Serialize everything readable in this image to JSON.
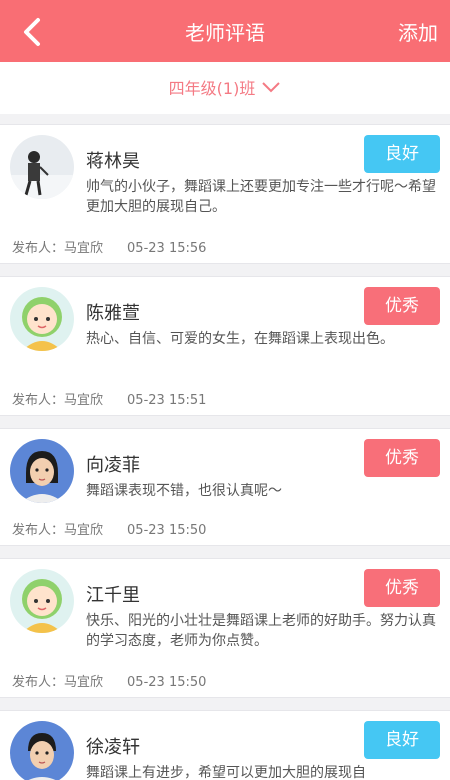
{
  "header": {
    "title": "老师评语",
    "add_label": "添加"
  },
  "class_selector": {
    "label": "四年级(1)班"
  },
  "meta_prefix": "发布人：",
  "colors": {
    "header": "#f96e74",
    "badge_good": "#45c7f3",
    "badge_excellent": "#f86f79"
  },
  "comments": [
    {
      "name": "蒋林昊",
      "badge": "良好",
      "badge_type": "good",
      "comment": "帅气的小伙子，舞蹈课上还要更加专注一些才行呢～希望更加大胆的展现自己。",
      "publisher": "马宜欣",
      "time": "05-23 15:56",
      "avatar_icon": "boy-photo-avatar"
    },
    {
      "name": "陈雅萱",
      "badge": "优秀",
      "badge_type": "excellent",
      "comment": "热心、自信、可爱的女生，在舞蹈课上表现出色。",
      "publisher": "马宜欣",
      "time": "05-23 15:51",
      "avatar_icon": "cartoon-avatar"
    },
    {
      "name": "向凌菲",
      "badge": "优秀",
      "badge_type": "excellent",
      "comment": "舞蹈课表现不错，也很认真呢～",
      "publisher": "马宜欣",
      "time": "05-23 15:50",
      "avatar_icon": "girl-photo-avatar"
    },
    {
      "name": "江千里",
      "badge": "优秀",
      "badge_type": "excellent",
      "comment": "快乐、阳光的小壮壮是舞蹈课上老师的好助手。努力认真的学习态度，老师为你点赞。",
      "publisher": "马宜欣",
      "time": "05-23 15:50",
      "avatar_icon": "cartoon-avatar"
    },
    {
      "name": "徐凌轩",
      "badge": "良好",
      "badge_type": "good",
      "comment": "舞蹈课上有进步，希望可以更加大胆的展现自",
      "publisher": "",
      "time": "",
      "avatar_icon": "boy-photo-avatar"
    }
  ]
}
